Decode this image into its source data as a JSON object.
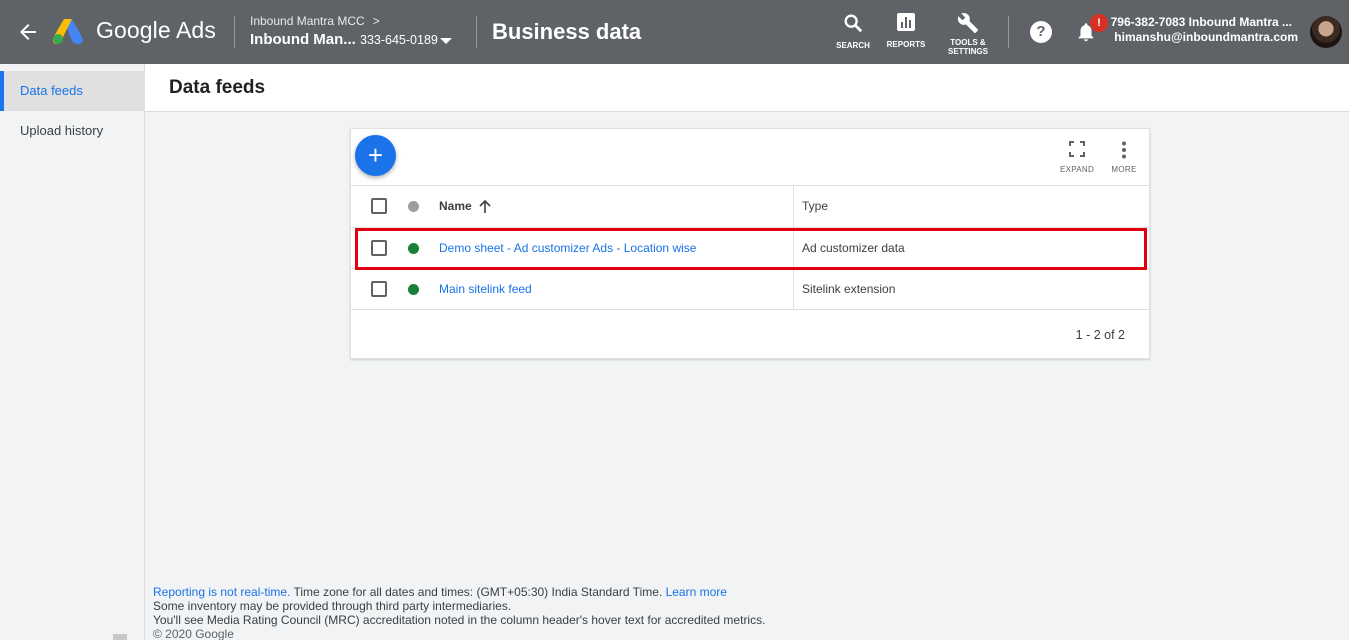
{
  "header": {
    "logo_text": "Google Ads",
    "account_parent": "Inbound Mantra MCC",
    "account_name": "Inbound Man...",
    "account_id": "333-645-0189",
    "page_title": "Business data",
    "tools": {
      "search": "SEARCH",
      "reports": "REPORTS",
      "tools_line1": "TOOLS &",
      "tools_line2": "SETTINGS"
    },
    "help_glyph": "?",
    "notification_badge": "!",
    "user_line1": "796-382-7083 Inbound Mantra ...",
    "user_line2": "himanshu@inboundmantra.com"
  },
  "sidebar": {
    "items": [
      {
        "label": "Data feeds"
      },
      {
        "label": "Upload history"
      }
    ]
  },
  "content": {
    "title": "Data feeds"
  },
  "table": {
    "add_glyph": "+",
    "toolbar": {
      "expand": "EXPAND",
      "more": "MORE"
    },
    "columns": {
      "name": "Name",
      "type": "Type"
    },
    "rows": [
      {
        "name": "Demo sheet - Ad customizer Ads - Location wise",
        "type": "Ad customizer data"
      },
      {
        "name": "Main sitelink feed",
        "type": "Sitelink extension"
      }
    ],
    "pagination": "1 - 2 of 2"
  },
  "footer": {
    "realtime_link": "Reporting is not real-time.",
    "timezone_text": " Time zone for all dates and times: (GMT+05:30) India Standard Time. ",
    "learn_more": "Learn more",
    "line2": "Some inventory may be provided through third party intermediaries.",
    "line3": "You'll see Media Rating Council (MRC) accreditation noted in the column header's hover text for accredited metrics.",
    "copyright": "© 2020 Google"
  },
  "colors": {
    "topbar": "#5f6368",
    "accent_blue": "#1a73e8",
    "status_enabled": "#188038",
    "status_header": "#9e9e9e",
    "highlight_red": "#e0000f"
  },
  "icons": [
    "arrow-back-icon",
    "google-ads-logo",
    "search-icon",
    "reports-icon",
    "wrench-icon",
    "help-icon",
    "bell-icon",
    "expand-icon",
    "more-vert-icon",
    "arrow-up-icon"
  ]
}
